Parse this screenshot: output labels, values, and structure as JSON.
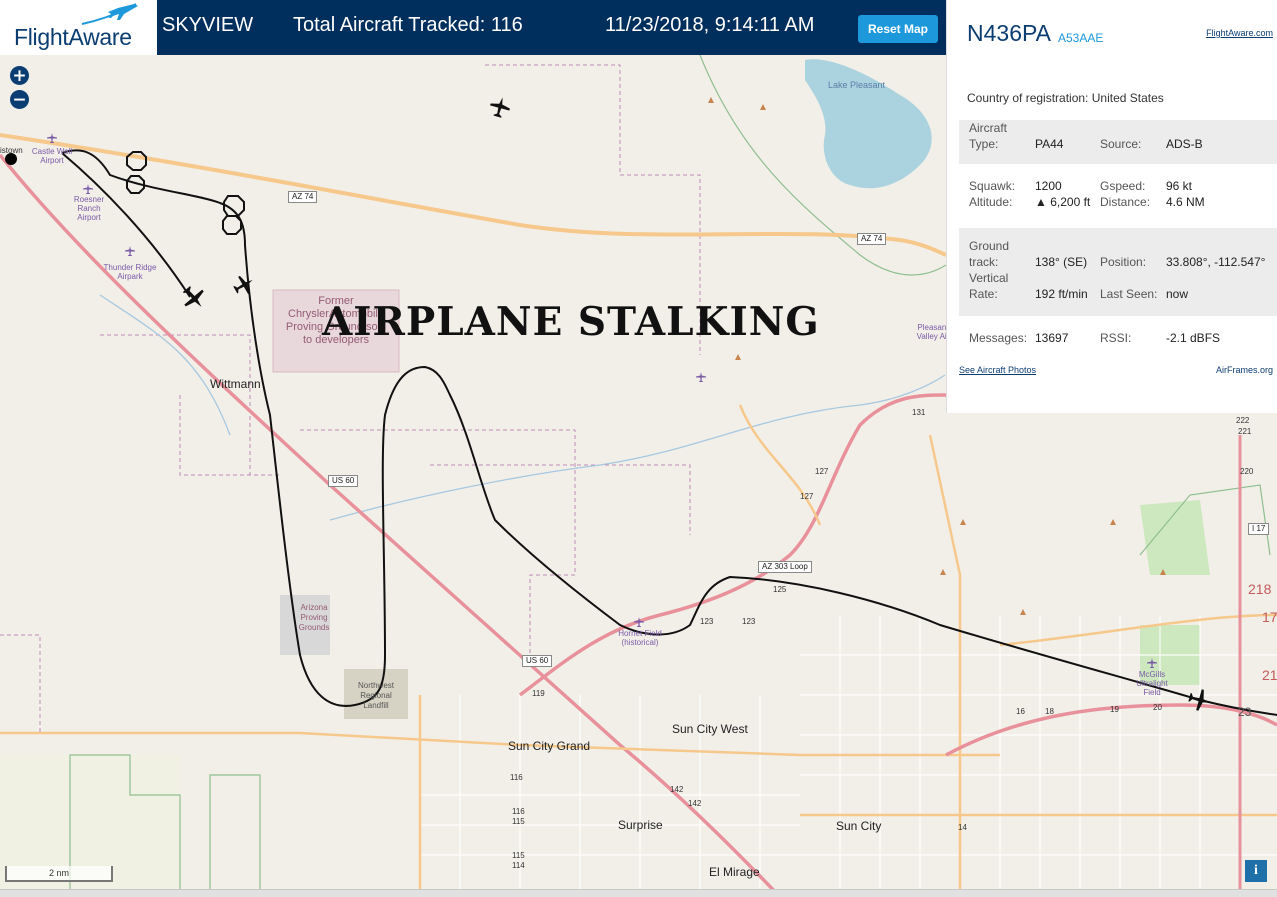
{
  "header": {
    "logo_text": "FlightAware",
    "app_name": "SKYVIEW",
    "tracked_label": "Total Aircraft Tracked: 116",
    "timestamp": "11/23/2018, 9:14:11 AM",
    "reset_label": "Reset Map"
  },
  "overlay_title": "AIRPLANE STALKING",
  "map": {
    "scale_label": "2 nm",
    "info_label": "i",
    "cities": [
      "Wittmann",
      "Sun City West",
      "Sun City Grand",
      "Surprise",
      "Sun City",
      "El Mirage"
    ],
    "poi": {
      "castle_well": "Castle Well Airport",
      "roesner": "Roesner Ranch Airport",
      "thunder": "Thunder Ridge Airpark",
      "hornet": "Hornet Field (historical)",
      "mcgills": "McGills Ultralight Field",
      "pleasant_valley": "Pleasant Valley Air"
    },
    "developed": {
      "chrysler": "Former ChryslerAutomobile Proving Ground sold to developers",
      "arizona": "Arizona Proving Grounds",
      "landfill": "Northwest Regional Landfill"
    },
    "water": "Lake Pleasant",
    "town_fragment": "istown",
    "shields": [
      "AZ 74",
      "AZ 74",
      "US 60",
      "US 60",
      "AZ 303 Loop",
      "I 17"
    ],
    "road_numbers": [
      "131",
      "127",
      "127",
      "125",
      "123",
      "123",
      "119",
      "116",
      "116",
      "115",
      "115",
      "114",
      "142",
      "142",
      "14",
      "16",
      "18",
      "19",
      "20",
      "222",
      "221",
      "220",
      "21",
      "23",
      "17",
      "218"
    ]
  },
  "panel": {
    "ident": "N436PA",
    "hex": "A53AAE",
    "fa_link": "FlightAware.com",
    "country_label": "Country of registration:",
    "country_value": "United States",
    "aircraft_type_label": "Aircraft Type:",
    "aircraft_type_value": "PA44",
    "source_label": "Source:",
    "source_value": "ADS-B",
    "squawk_label": "Squawk:",
    "squawk_value": "1200",
    "gspeed_label": "Gspeed:",
    "gspeed_value": "96 kt",
    "altitude_label": "Altitude:",
    "altitude_value": "▲ 6,200 ft",
    "distance_label": "Distance:",
    "distance_value": "4.6 NM",
    "ground_track_label": "Ground track:",
    "ground_track_value": "138° (SE)",
    "position_label": "Position:",
    "position_value": "33.808°, -112.547°",
    "vertical_rate_label": "Vertical Rate:",
    "vertical_rate_value": "192 ft/min",
    "last_seen_label": "Last Seen:",
    "last_seen_value": "now",
    "messages_label": "Messages:",
    "messages_value": "13697",
    "rssi_label": "RSSI:",
    "rssi_value": "-2.1 dBFS",
    "photos_link": "See Aircraft Photos",
    "airframes_link": "AirFrames.org"
  },
  "colors": {
    "header_bg": "#002f5d",
    "accent": "#1c98db",
    "brand": "#0b3d72",
    "highway": "#e8919b",
    "major_road": "#f6c88b",
    "water": "#aad3df",
    "track": "#111111"
  }
}
